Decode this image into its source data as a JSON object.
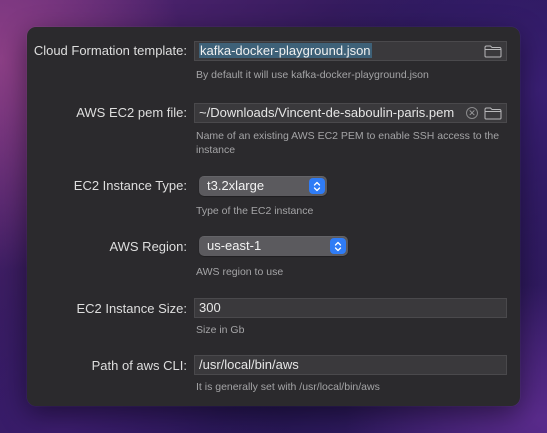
{
  "colors": {
    "accent": "#2f7cf6",
    "selection": "#3e6178",
    "panel": "#2b2a2d"
  },
  "cloud_formation": {
    "label": "Cloud Formation template:",
    "value": "kafka-docker-playground.json",
    "help": "By default it will use kafka-docker-playground.json",
    "icon": "folder-icon"
  },
  "pem_file": {
    "label": "AWS EC2 pem file:",
    "value": "~/Downloads/Vincent-de-saboulin-paris.pem",
    "help": "Name of an existing AWS EC2 PEM to enable SSH access to the instance",
    "clear_glyph": "✕",
    "icon": "folder-icon"
  },
  "instance_type": {
    "label": "EC2 Instance Type:",
    "selected": "t3.2xlarge",
    "help": "Type of the EC2 instance"
  },
  "region": {
    "label": "AWS Region:",
    "selected": "us-east-1",
    "help": "AWS region to use"
  },
  "instance_size": {
    "label": "EC2 Instance Size:",
    "value": "300",
    "help": "Size in Gb"
  },
  "aws_cli": {
    "label": "Path of aws CLI:",
    "value": "/usr/local/bin/aws",
    "help": "It is generally set with /usr/local/bin/aws"
  }
}
